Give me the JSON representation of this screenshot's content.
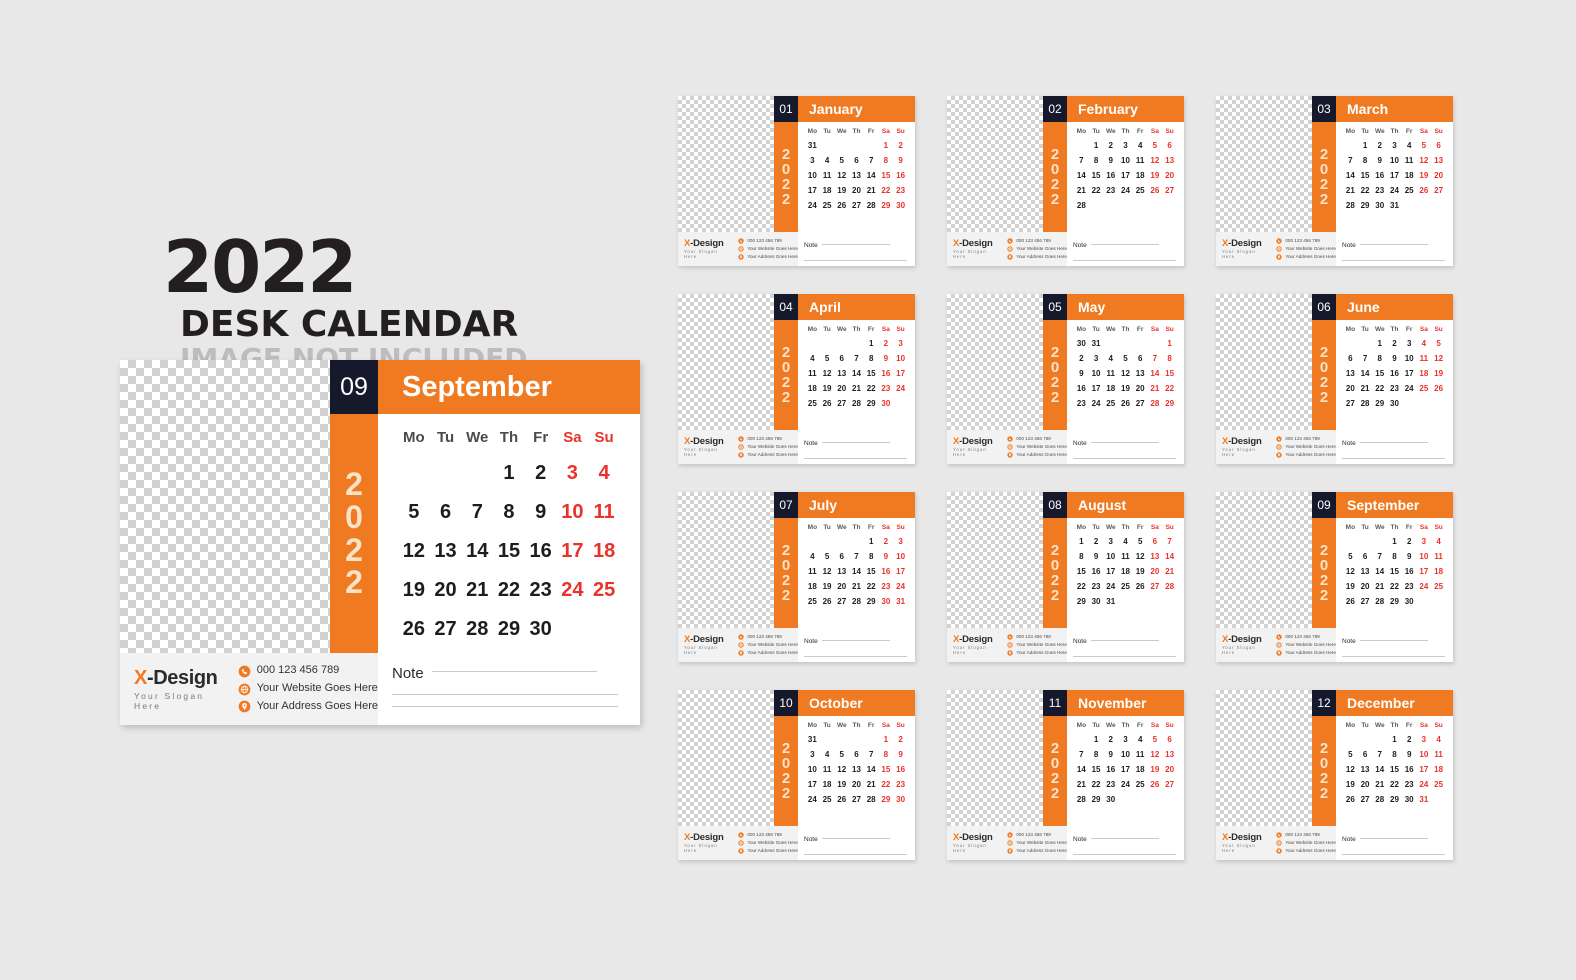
{
  "title": {
    "year": "2022",
    "main": "DESK CALENDAR",
    "sub": "IMAGE NOT INCLUDED"
  },
  "colors": {
    "orange": "#ef7a21",
    "dark": "#15192b",
    "weekend_red": "#e8322a",
    "background": "#e8e8e8",
    "year_text": "#fbe3c9"
  },
  "year": "2022",
  "weekdays": [
    "Mo",
    "Tu",
    "We",
    "Th",
    "Fr",
    "Sa",
    "Su"
  ],
  "note": {
    "label": "Note"
  },
  "brand": {
    "name_x": "X",
    "name_rest": "-Design",
    "slogan": "Your Slogan Here",
    "phone": "000 123 456 789",
    "website": "Your Website Goes Here",
    "address": "Your Address Goes Here",
    "phone_icon": "phone-icon",
    "website_icon": "globe-icon",
    "address_icon": "location-pin-icon"
  },
  "featured": {
    "number": "09",
    "name": "September",
    "year": "2022"
  },
  "chart_data": {
    "type": "table",
    "title": "2022 Desk Calendar",
    "note": "Monday-first week layout; Saturday and Sunday rendered in red"
  },
  "months": [
    {
      "number": "01",
      "name": "January",
      "weeks": [
        [
          "31",
          "",
          "",
          "",
          "",
          "1",
          "2"
        ],
        [
          "3",
          "4",
          "5",
          "6",
          "7",
          "8",
          "9"
        ],
        [
          "10",
          "11",
          "12",
          "13",
          "14",
          "15",
          "16"
        ],
        [
          "17",
          "18",
          "19",
          "20",
          "21",
          "22",
          "23"
        ],
        [
          "24",
          "25",
          "26",
          "27",
          "28",
          "29",
          "30"
        ]
      ]
    },
    {
      "number": "02",
      "name": "February",
      "weeks": [
        [
          "",
          "1",
          "2",
          "3",
          "4",
          "5",
          "6"
        ],
        [
          "7",
          "8",
          "9",
          "10",
          "11",
          "12",
          "13"
        ],
        [
          "14",
          "15",
          "16",
          "17",
          "18",
          "19",
          "20"
        ],
        [
          "21",
          "22",
          "23",
          "24",
          "25",
          "26",
          "27"
        ],
        [
          "28",
          "",
          "",
          "",
          "",
          "",
          ""
        ]
      ]
    },
    {
      "number": "03",
      "name": "March",
      "weeks": [
        [
          "",
          "1",
          "2",
          "3",
          "4",
          "5",
          "6"
        ],
        [
          "7",
          "8",
          "9",
          "10",
          "11",
          "12",
          "13"
        ],
        [
          "14",
          "15",
          "16",
          "17",
          "18",
          "19",
          "20"
        ],
        [
          "21",
          "22",
          "23",
          "24",
          "25",
          "26",
          "27"
        ],
        [
          "28",
          "29",
          "30",
          "31",
          "",
          "",
          ""
        ]
      ]
    },
    {
      "number": "04",
      "name": "April",
      "weeks": [
        [
          "",
          "",
          "",
          "",
          "1",
          "2",
          "3"
        ],
        [
          "4",
          "5",
          "6",
          "7",
          "8",
          "9",
          "10"
        ],
        [
          "11",
          "12",
          "13",
          "14",
          "15",
          "16",
          "17"
        ],
        [
          "18",
          "19",
          "20",
          "21",
          "22",
          "23",
          "24"
        ],
        [
          "25",
          "26",
          "27",
          "28",
          "29",
          "30",
          ""
        ]
      ]
    },
    {
      "number": "05",
      "name": "May",
      "weeks": [
        [
          "30",
          "31",
          "",
          "",
          "",
          "",
          "1"
        ],
        [
          "2",
          "3",
          "4",
          "5",
          "6",
          "7",
          "8"
        ],
        [
          "9",
          "10",
          "11",
          "12",
          "13",
          "14",
          "15"
        ],
        [
          "16",
          "17",
          "18",
          "19",
          "20",
          "21",
          "22"
        ],
        [
          "23",
          "24",
          "25",
          "26",
          "27",
          "28",
          "29"
        ]
      ]
    },
    {
      "number": "06",
      "name": "June",
      "weeks": [
        [
          "",
          "",
          "1",
          "2",
          "3",
          "4",
          "5"
        ],
        [
          "6",
          "7",
          "8",
          "9",
          "10",
          "11",
          "12"
        ],
        [
          "13",
          "14",
          "15",
          "16",
          "17",
          "18",
          "19"
        ],
        [
          "20",
          "21",
          "22",
          "23",
          "24",
          "25",
          "26"
        ],
        [
          "27",
          "28",
          "29",
          "30",
          "",
          "",
          ""
        ]
      ]
    },
    {
      "number": "07",
      "name": "July",
      "weeks": [
        [
          "",
          "",
          "",
          "",
          "1",
          "2",
          "3"
        ],
        [
          "4",
          "5",
          "6",
          "7",
          "8",
          "9",
          "10"
        ],
        [
          "11",
          "12",
          "13",
          "14",
          "15",
          "16",
          "17"
        ],
        [
          "18",
          "19",
          "20",
          "21",
          "22",
          "23",
          "24"
        ],
        [
          "25",
          "26",
          "27",
          "28",
          "29",
          "30",
          "31"
        ]
      ]
    },
    {
      "number": "08",
      "name": "August",
      "weeks": [
        [
          "1",
          "2",
          "3",
          "4",
          "5",
          "6",
          "7"
        ],
        [
          "8",
          "9",
          "10",
          "11",
          "12",
          "13",
          "14"
        ],
        [
          "15",
          "16",
          "17",
          "18",
          "19",
          "20",
          "21"
        ],
        [
          "22",
          "23",
          "24",
          "25",
          "26",
          "27",
          "28"
        ],
        [
          "29",
          "30",
          "31",
          "",
          "",
          "",
          ""
        ]
      ]
    },
    {
      "number": "09",
      "name": "September",
      "weeks": [
        [
          "",
          "",
          "",
          "1",
          "2",
          "3",
          "4"
        ],
        [
          "5",
          "6",
          "7",
          "8",
          "9",
          "10",
          "11"
        ],
        [
          "12",
          "13",
          "14",
          "15",
          "16",
          "17",
          "18"
        ],
        [
          "19",
          "20",
          "21",
          "22",
          "23",
          "24",
          "25"
        ],
        [
          "26",
          "27",
          "28",
          "29",
          "30",
          "",
          ""
        ]
      ]
    },
    {
      "number": "10",
      "name": "October",
      "weeks": [
        [
          "31",
          "",
          "",
          "",
          "",
          "1",
          "2"
        ],
        [
          "3",
          "4",
          "5",
          "6",
          "7",
          "8",
          "9"
        ],
        [
          "10",
          "11",
          "12",
          "13",
          "14",
          "15",
          "16"
        ],
        [
          "17",
          "18",
          "19",
          "20",
          "21",
          "22",
          "23"
        ],
        [
          "24",
          "25",
          "26",
          "27",
          "28",
          "29",
          "30"
        ]
      ]
    },
    {
      "number": "11",
      "name": "November",
      "weeks": [
        [
          "",
          "1",
          "2",
          "3",
          "4",
          "5",
          "6"
        ],
        [
          "7",
          "8",
          "9",
          "10",
          "11",
          "12",
          "13"
        ],
        [
          "14",
          "15",
          "16",
          "17",
          "18",
          "19",
          "20"
        ],
        [
          "21",
          "22",
          "23",
          "24",
          "25",
          "26",
          "27"
        ],
        [
          "28",
          "29",
          "30",
          "",
          "",
          "",
          ""
        ]
      ]
    },
    {
      "number": "12",
      "name": "December",
      "weeks": [
        [
          "",
          "",
          "",
          "1",
          "2",
          "3",
          "4"
        ],
        [
          "5",
          "6",
          "7",
          "8",
          "9",
          "10",
          "11"
        ],
        [
          "12",
          "13",
          "14",
          "15",
          "16",
          "17",
          "18"
        ],
        [
          "19",
          "20",
          "21",
          "22",
          "23",
          "24",
          "25"
        ],
        [
          "26",
          "27",
          "28",
          "29",
          "30",
          "31",
          ""
        ]
      ]
    }
  ]
}
